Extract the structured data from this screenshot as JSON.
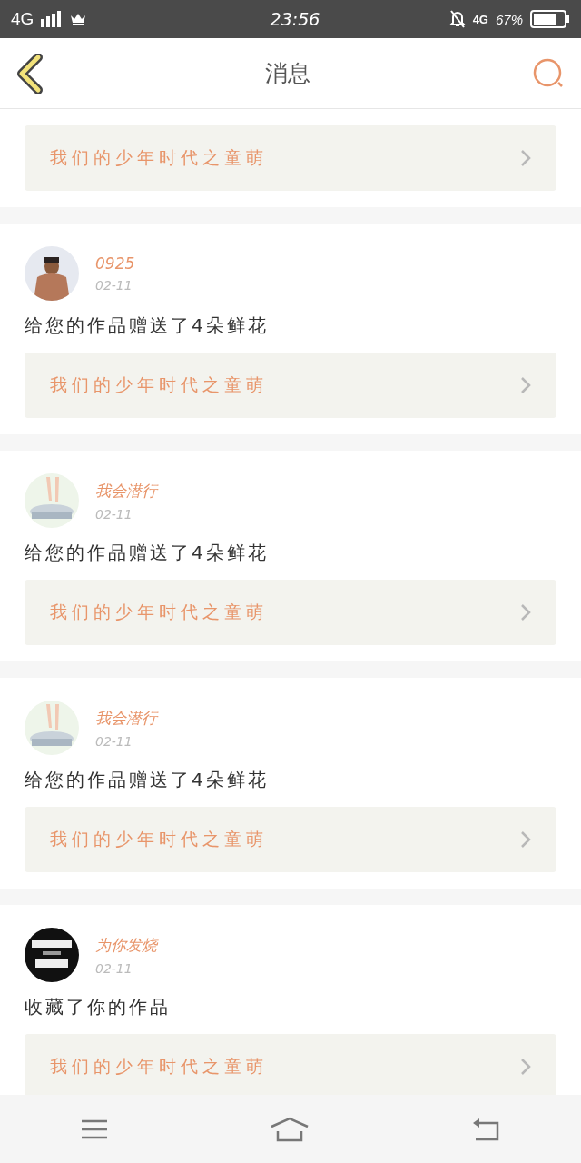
{
  "status_bar": {
    "network": "4G",
    "time": "23:56",
    "data_network": "4G",
    "battery": "67%"
  },
  "header": {
    "title": "消息"
  },
  "messages": [
    {
      "link": "我们的少年时代之童萌"
    },
    {
      "user": "0925",
      "date": "02-11",
      "text": "给您的作品赠送了4朵鲜花",
      "link": "我们的少年时代之童萌"
    },
    {
      "user": "我会潜行",
      "date": "02-11",
      "text": "给您的作品赠送了4朵鲜花",
      "link": "我们的少年时代之童萌"
    },
    {
      "user": "我会潜行",
      "date": "02-11",
      "text": "给您的作品赠送了4朵鲜花",
      "link": "我们的少年时代之童萌"
    },
    {
      "user": "为你发烧",
      "date": "02-11",
      "text": "收藏了你的作品",
      "link": "我们的少年时代之童萌"
    }
  ]
}
